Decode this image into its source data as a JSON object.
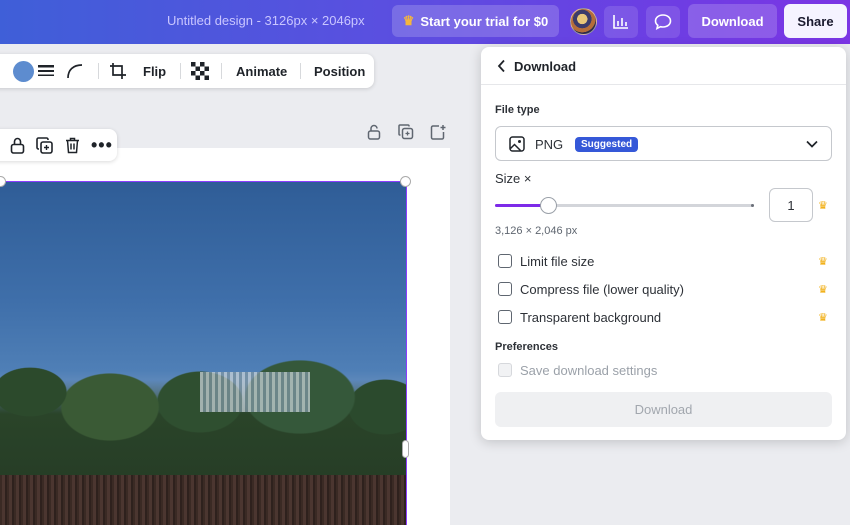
{
  "header": {
    "design_title": "Untitled design - 3126px × 2046px",
    "trial_label": "Start your trial for $0",
    "download_label": "Download",
    "share_label": "Share"
  },
  "toolbar": {
    "flip_label": "Flip",
    "animate_label": "Animate",
    "position_label": "Position",
    "fill_color": "#5d8ccf"
  },
  "download_panel": {
    "title": "Download",
    "file_type_label": "File type",
    "file_type_value": "PNG",
    "suggested_badge": "Suggested",
    "size_label": "Size ×",
    "size_value": "1",
    "size_slider_fraction": 0.21,
    "dimensions": "3,126 × 2,046 px",
    "options": [
      {
        "label": "Limit file size",
        "checked": false,
        "premium": true
      },
      {
        "label": "Compress file (lower quality)",
        "checked": false,
        "premium": true
      },
      {
        "label": "Transparent background",
        "checked": false,
        "premium": true
      }
    ],
    "preferences_label": "Preferences",
    "save_settings_label": "Save download settings",
    "download_button_label": "Download"
  },
  "colors": {
    "accent": "#7d2ae8",
    "badge": "#3558d8",
    "crown": "#f0a800"
  }
}
